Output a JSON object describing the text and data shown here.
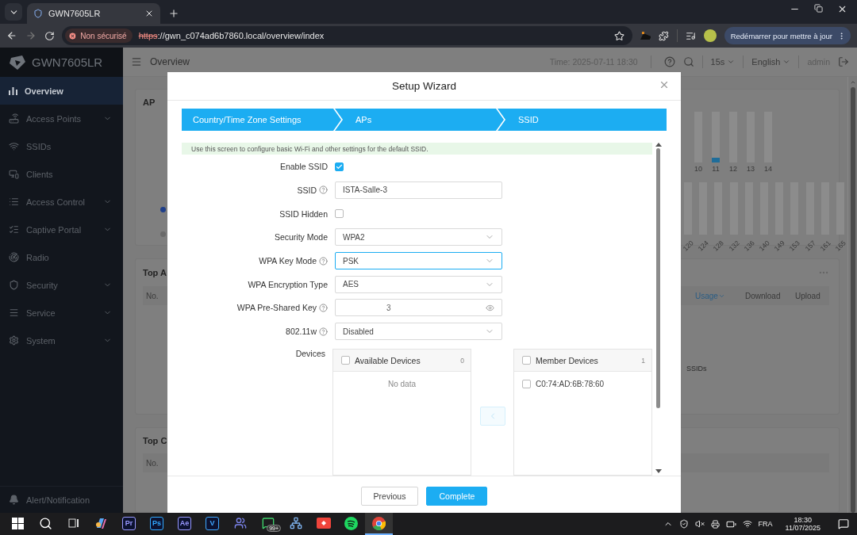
{
  "browser": {
    "tabs": [
      {
        "title": "GWN7605LR",
        "selected": true
      }
    ],
    "security_chip": "Non sécurisé",
    "url_scheme": "https",
    "url_rest": "://gwn_c074ad6b7860.local/overview/index",
    "update_button": "Redémarrer pour mettre à jour"
  },
  "app_header": {
    "logo": "GWN7605LR",
    "page_title": "Overview",
    "time": "Time: 2025-07-11 18:30",
    "refresh": "15s",
    "language": "English",
    "user": "admin"
  },
  "sidebar": {
    "items": [
      {
        "label": "Overview",
        "selected": true,
        "expandable": false
      },
      {
        "label": "Access Points",
        "selected": false,
        "expandable": true
      },
      {
        "label": "SSIDs",
        "selected": false,
        "expandable": false
      },
      {
        "label": "Clients",
        "selected": false,
        "expandable": false
      },
      {
        "label": "Access Control",
        "selected": false,
        "expandable": true
      },
      {
        "label": "Captive Portal",
        "selected": false,
        "expandable": true
      },
      {
        "label": "Radio",
        "selected": false,
        "expandable": false
      },
      {
        "label": "Security",
        "selected": false,
        "expandable": true
      },
      {
        "label": "Service",
        "selected": false,
        "expandable": true
      },
      {
        "label": "System",
        "selected": false,
        "expandable": true
      }
    ],
    "footer": "Alert/Notification"
  },
  "dashboard": {
    "ap_card": {
      "title": "AP",
      "channels_24": [
        {
          "label": "10"
        },
        {
          "label": "11",
          "level": 0.1
        },
        {
          "label": "12"
        },
        {
          "label": "13"
        },
        {
          "label": "14"
        }
      ],
      "channels_5": [
        "120",
        "124",
        "128",
        "132",
        "136",
        "140",
        "149",
        "153",
        "157",
        "161",
        "165"
      ]
    },
    "top_a": {
      "title": "Top A",
      "columns": [
        "No.",
        "Usage",
        "Download",
        "Upload"
      ],
      "empty_text": "SSIDs"
    },
    "top_c": {
      "title": "Top C",
      "columns": [
        "No."
      ]
    }
  },
  "wizard": {
    "title": "Setup Wizard",
    "steps": [
      "Country/Time Zone Settings",
      "APs",
      "SSID"
    ],
    "notice": "Use this screen to configure basic Wi-Fi and other settings for the default SSID.",
    "rows": [
      {
        "kind": "checkbox",
        "label": "Enable SSID",
        "help": false,
        "checked": true
      },
      {
        "kind": "text",
        "label": "SSID",
        "help": true,
        "value": "ISTA-Salle-3",
        "focused": false
      },
      {
        "kind": "checkbox",
        "label": "SSID Hidden",
        "help": false,
        "checked": false
      },
      {
        "kind": "select",
        "label": "Security Mode",
        "help": false,
        "value": "WPA2",
        "focused": false
      },
      {
        "kind": "select",
        "label": "WPA Key Mode",
        "help": true,
        "value": "PSK",
        "focused": true
      },
      {
        "kind": "select",
        "label": "WPA Encryption Type",
        "help": false,
        "value": "AES",
        "focused": false
      },
      {
        "kind": "password",
        "label": "WPA Pre-Shared Key",
        "help": true,
        "value": "3",
        "focused": false
      },
      {
        "kind": "select",
        "label": "802.11w",
        "help": true,
        "value": "Disabled",
        "focused": false
      },
      {
        "kind": "devices",
        "label": "Devices",
        "help": false,
        "available": {
          "title": "Available Devices",
          "count": "0",
          "checked": false,
          "empty_text": "No data"
        },
        "member": {
          "title": "Member Devices",
          "count": "1",
          "checked": false,
          "items": [
            {
              "label": "C0:74:AD:6B:78:60",
              "checked": false
            }
          ]
        },
        "move_left_disabled": true
      }
    ],
    "buttons": [
      {
        "label": "Previous",
        "primary": false
      },
      {
        "label": "Complete",
        "primary": true
      }
    ]
  },
  "taskbar": {
    "apps": [
      {
        "kind": "windows",
        "selected": false
      },
      {
        "kind": "search",
        "selected": false
      },
      {
        "kind": "taskview",
        "selected": false
      },
      {
        "kind": "copilot",
        "selected": false
      },
      {
        "kind": "letter",
        "label": "Pr",
        "color": "#9999ff",
        "selected": false
      },
      {
        "kind": "letter",
        "label": "Ps",
        "color": "#31a8ff",
        "selected": false
      },
      {
        "kind": "letter",
        "label": "Ae",
        "color": "#9999ff",
        "selected": false
      },
      {
        "kind": "letter",
        "label": "V",
        "color": "#3ea6ff",
        "selected": false
      },
      {
        "kind": "teams",
        "selected": false
      },
      {
        "kind": "whatsapp",
        "badge": "99+",
        "selected": false
      },
      {
        "kind": "network",
        "selected": false
      },
      {
        "kind": "anydesk",
        "selected": false
      },
      {
        "kind": "spotify",
        "selected": false
      },
      {
        "kind": "chrome",
        "selected": true
      }
    ],
    "language": "FRA",
    "time": "18:30",
    "date": "11/07/2025"
  }
}
